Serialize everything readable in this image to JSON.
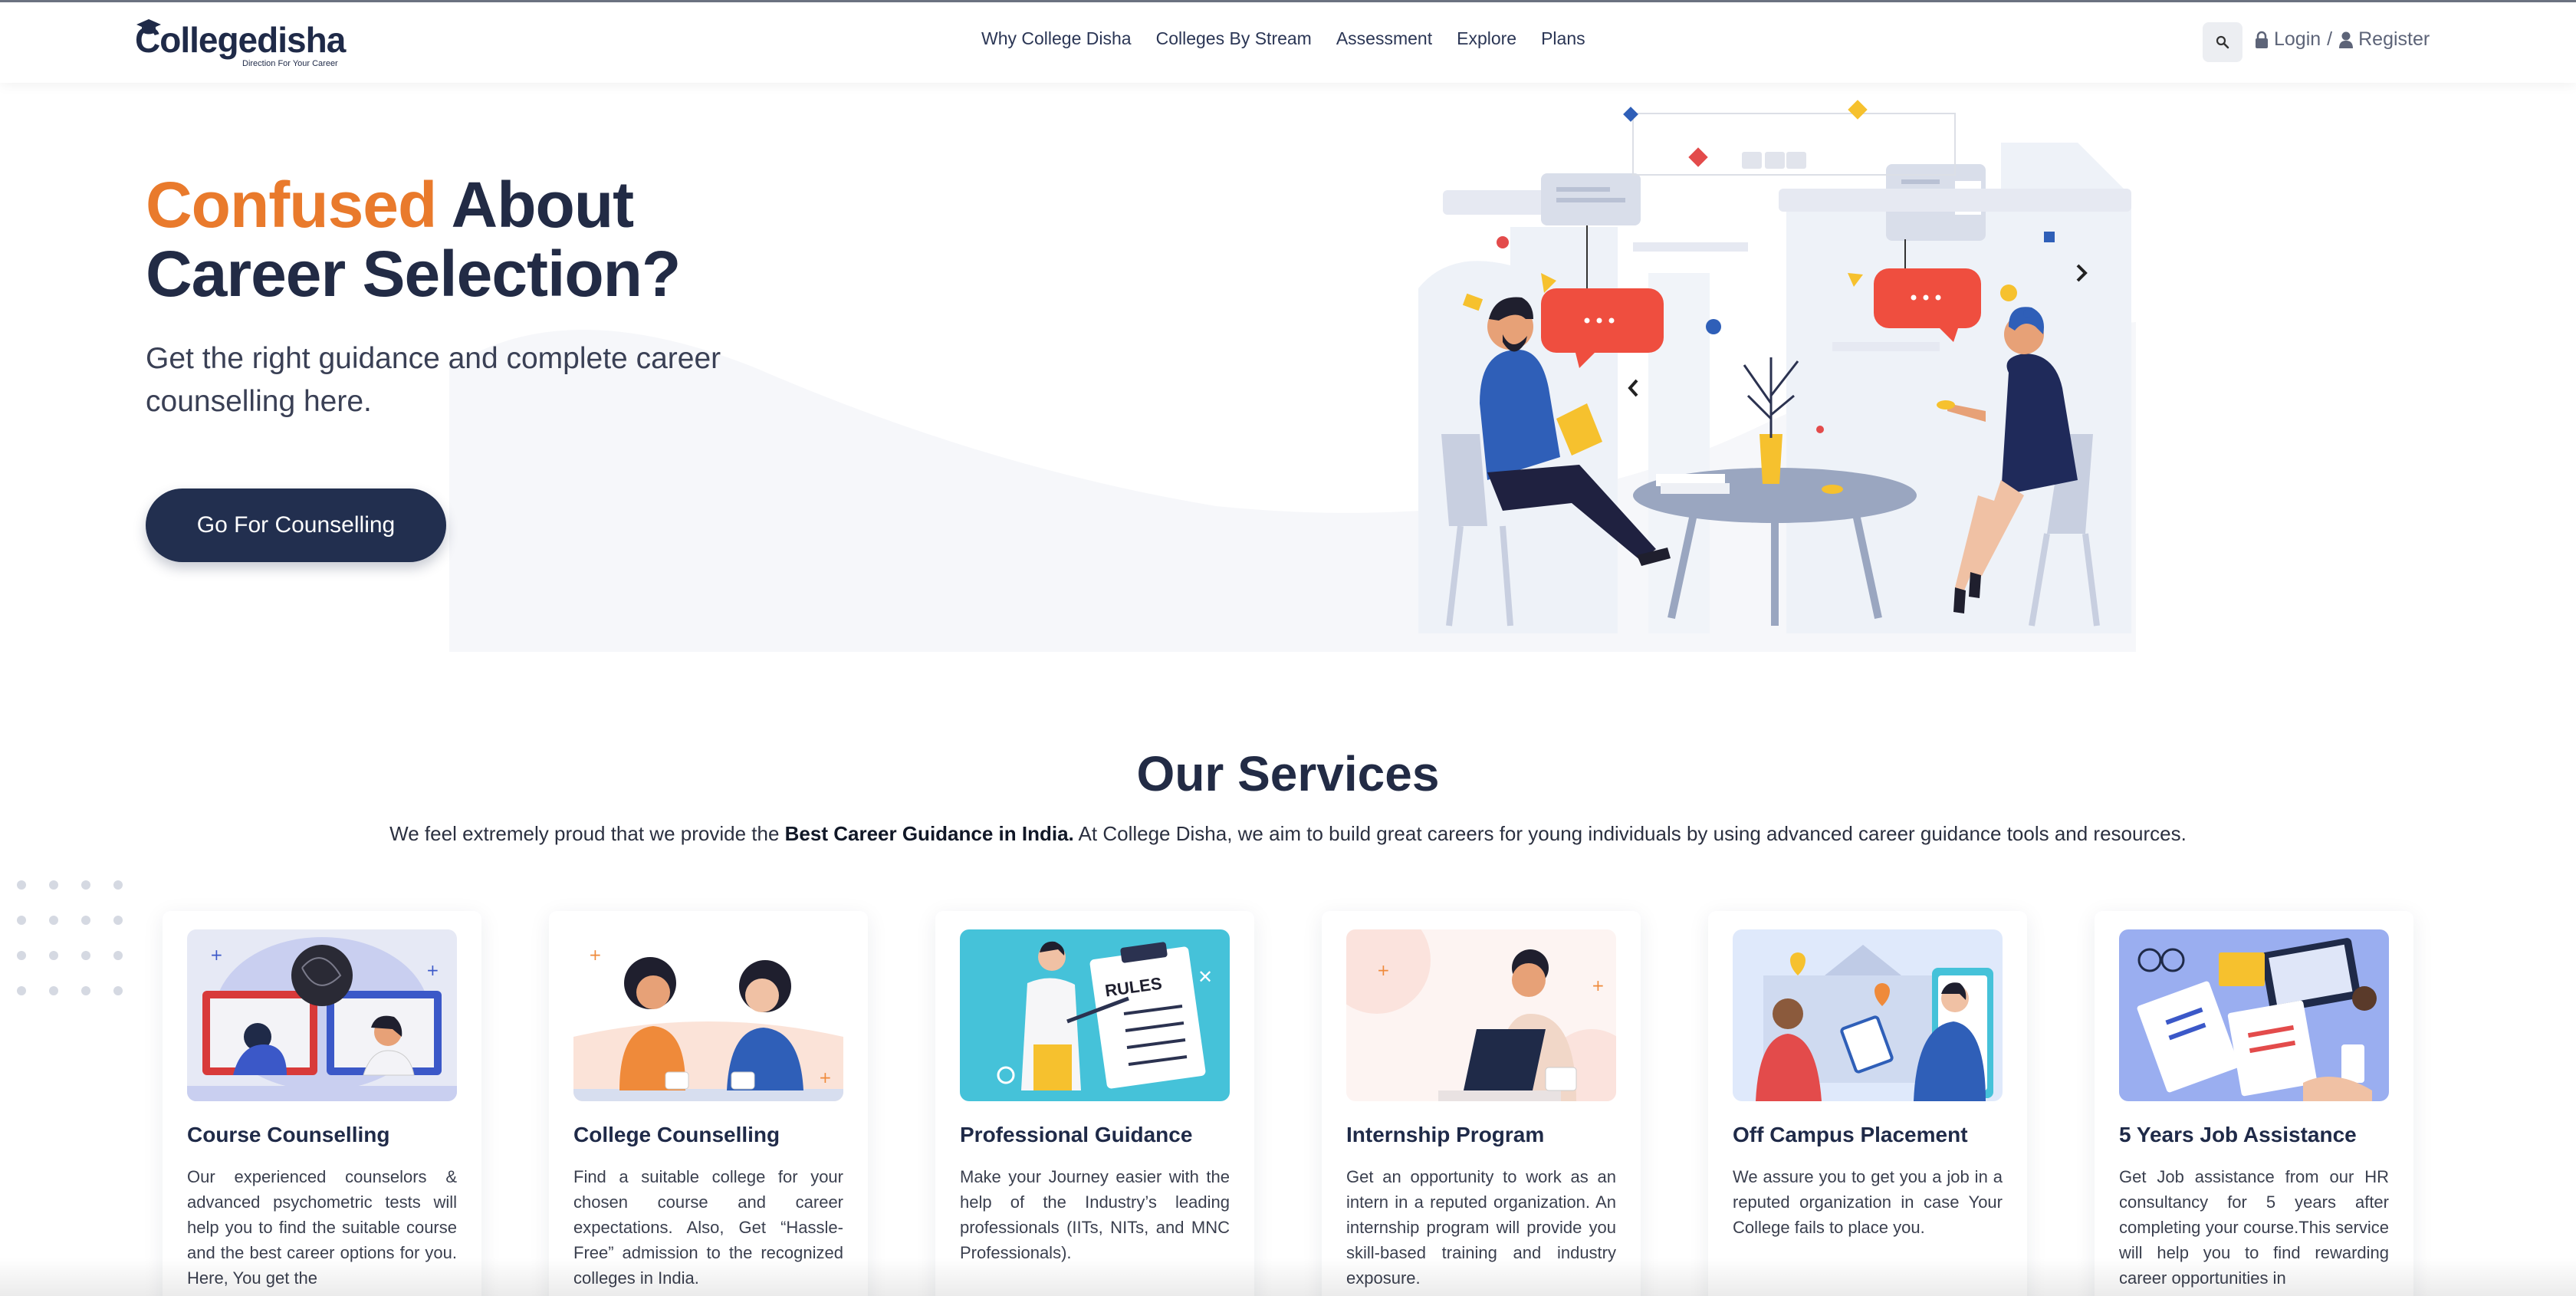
{
  "brand": {
    "name": "Collegedisha",
    "tagline": "Direction For Your Career"
  },
  "nav": {
    "links": [
      "Why College Disha",
      "Colleges By Stream",
      "Assessment",
      "Explore",
      "Plans"
    ],
    "login": "Login",
    "separator": "/",
    "register": "Register"
  },
  "hero": {
    "title_accent": "Confused",
    "title_rest": "About",
    "title_line2": "Career Selection?",
    "subtitle": "Get the right guidance and complete career counselling here.",
    "cta": "Go For Counselling"
  },
  "services": {
    "title": "Our Services",
    "desc_pre": "We feel extremely proud that we provide the ",
    "desc_bold": "Best Career Guidance in India.",
    "desc_post": " At College Disha, we aim to build great careers for young individuals by using advanced career guidance tools and resources.",
    "cards": [
      {
        "title": "Course Counselling",
        "text": "Our experienced counselors & advanced psychometric tests will help you to find the suitable course and the best career options for you. Here, You get the"
      },
      {
        "title": "College Counselling",
        "text": "Find a suitable college for your chosen course and career expectations. Also, Get “Hassle-Free” admission to the recognized colleges in India."
      },
      {
        "title": "Professional Guidance",
        "text": "Make your Journey easier with the help of the Industry’s leading professionals (IITs, NITs, and MNC Professionals)."
      },
      {
        "title": "Internship Program",
        "text": "Get an opportunity to work as an intern in a reputed organization. An internship program will provide you skill-based training and industry exposure."
      },
      {
        "title": "Off Campus Placement",
        "text": "We assure you to get you a job in a reputed organization in case Your College fails to place you."
      },
      {
        "title": "5 Years Job Assistance",
        "text": "Get Job assistance from our HR consultancy for 5 years after completing your course.This service will help you to find rewarding career opportunities in"
      }
    ],
    "rules_label": "RULES"
  },
  "colors": {
    "accent": "#e97a2c",
    "navy": "#222f4f",
    "text": "#222b45"
  }
}
